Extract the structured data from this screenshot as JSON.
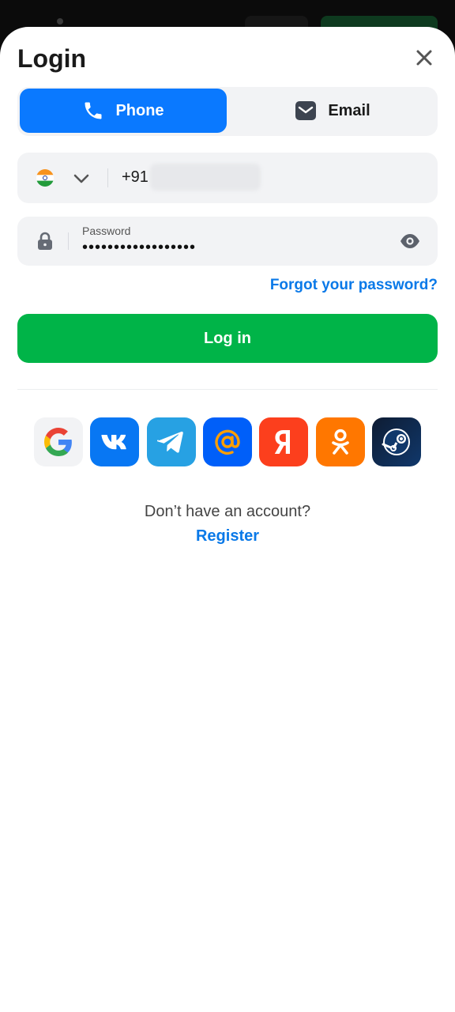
{
  "header": {
    "title": "Login",
    "close_icon": "close-icon"
  },
  "tabs": [
    {
      "label": "Phone",
      "icon": "phone-icon",
      "active": true
    },
    {
      "label": "Email",
      "icon": "mail-icon",
      "active": false
    }
  ],
  "phone_field": {
    "country_icon": "india-flag-icon",
    "dial_code": "+91",
    "value_hidden": true
  },
  "password_field": {
    "label": "Password",
    "value": "••••••••••••••••••"
  },
  "forgot_link": "Forgot your password?",
  "login_button": "Log in",
  "social_logins": [
    "google-icon",
    "vk-icon",
    "telegram-icon",
    "mail-ru-icon",
    "yandex-icon",
    "odnoklassniki-icon",
    "steam-icon"
  ],
  "footer": {
    "prompt": "Don’t have an account?",
    "register_link": "Register"
  },
  "colors": {
    "primary_blue": "#0a79ff",
    "link_blue": "#0a79e8",
    "login_green": "#00b448"
  }
}
